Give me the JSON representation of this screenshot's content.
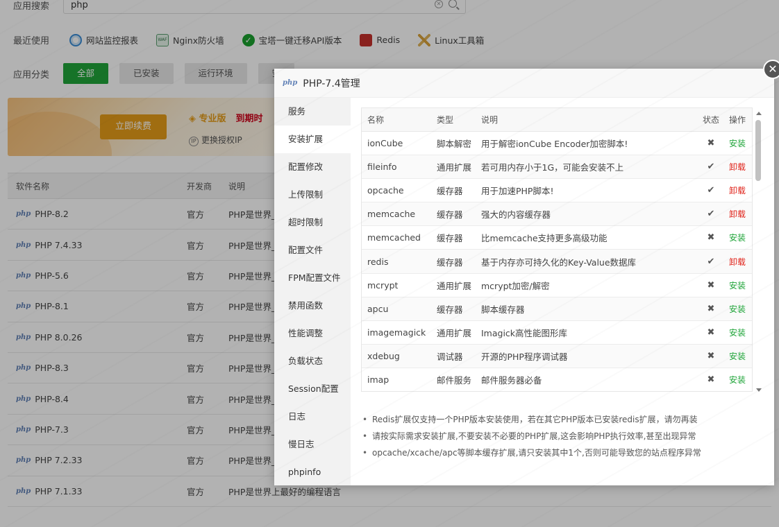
{
  "background": {
    "search_label": "应用搜索",
    "search_value": "php",
    "recent_label": "最近使用",
    "recent_items": [
      "网站监控报表",
      "Nginx防火墙",
      "宝塔一键迁移API版本",
      "Redis",
      "Linux工具箱"
    ],
    "category_label": "应用分类",
    "categories": [
      "全部",
      "已安装",
      "运行环境",
      "安"
    ],
    "banner": {
      "renew_label": "立即续费",
      "pro_label": "专业版",
      "expire_label": "到期时",
      "change_ip_label": "更换授权IP"
    },
    "table": {
      "headers": [
        "软件名称",
        "开发商",
        "说明"
      ],
      "rows": [
        {
          "name": "PHP-8.2",
          "vendor": "官方",
          "desc": "PHP是世界_"
        },
        {
          "name": "PHP 7.4.33",
          "vendor": "官方",
          "desc": "PHP是世界_"
        },
        {
          "name": "PHP-5.6",
          "vendor": "官方",
          "desc": "PHP是世界_"
        },
        {
          "name": "PHP-8.1",
          "vendor": "官方",
          "desc": "PHP是世界_"
        },
        {
          "name": "PHP 8.0.26",
          "vendor": "官方",
          "desc": "PHP是世界_"
        },
        {
          "name": "PHP-8.3",
          "vendor": "官方",
          "desc": "PHP是世界_"
        },
        {
          "name": "PHP-8.4",
          "vendor": "官方",
          "desc": "PHP是世界_"
        },
        {
          "name": "PHP-7.3",
          "vendor": "官方",
          "desc": "PHP是世界_"
        },
        {
          "name": "PHP 7.2.33",
          "vendor": "官方",
          "desc": "PHP是世界_"
        },
        {
          "name": "PHP 7.1.33",
          "vendor": "官方",
          "desc": "PHP是世界上最好的编程语言"
        }
      ]
    }
  },
  "modal": {
    "title": "PHP-7.4管理",
    "close_icon": "close-icon",
    "sidebar": [
      "服务",
      "安装扩展",
      "配置修改",
      "上传限制",
      "超时限制",
      "配置文件",
      "FPM配置文件",
      "禁用函数",
      "性能调整",
      "负载状态",
      "Session配置",
      "日志",
      "慢日志",
      "phpinfo"
    ],
    "active_sidebar_index": 1,
    "table": {
      "headers": {
        "name": "名称",
        "type": "类型",
        "desc": "说明",
        "status": "状态",
        "op": "操作"
      },
      "rows": [
        {
          "name": "ionCube",
          "type": "脚本解密",
          "desc": "用于解密ionCube Encoder加密脚本!",
          "status": "✖",
          "op": "安装",
          "installed": false
        },
        {
          "name": "fileinfo",
          "type": "通用扩展",
          "desc": "若可用内存小于1G，可能会安装不上",
          "status": "✔",
          "op": "卸载",
          "installed": true
        },
        {
          "name": "opcache",
          "type": "缓存器",
          "desc": "用于加速PHP脚本!",
          "status": "✔",
          "op": "卸载",
          "installed": true
        },
        {
          "name": "memcache",
          "type": "缓存器",
          "desc": "强大的内容缓存器",
          "status": "✔",
          "op": "卸载",
          "installed": true
        },
        {
          "name": "memcached",
          "type": "缓存器",
          "desc": "比memcache支持更多高级功能",
          "status": "✖",
          "op": "安装",
          "installed": false
        },
        {
          "name": "redis",
          "type": "缓存器",
          "desc": "基于内存亦可持久化的Key-Value数据库",
          "status": "✔",
          "op": "卸载",
          "installed": true
        },
        {
          "name": "mcrypt",
          "type": "通用扩展",
          "desc": "mcrypt加密/解密",
          "status": "✖",
          "op": "安装",
          "installed": false
        },
        {
          "name": "apcu",
          "type": "缓存器",
          "desc": "脚本缓存器",
          "status": "✖",
          "op": "安装",
          "installed": false
        },
        {
          "name": "imagemagick",
          "type": "通用扩展",
          "desc": "Imagick高性能图形库",
          "status": "✖",
          "op": "安装",
          "installed": false
        },
        {
          "name": "xdebug",
          "type": "调试器",
          "desc": "开源的PHP程序调试器",
          "status": "✖",
          "op": "安装",
          "installed": false
        },
        {
          "name": "imap",
          "type": "邮件服务",
          "desc": "邮件服务器必备",
          "status": "✖",
          "op": "安装",
          "installed": false
        }
      ]
    },
    "tips": [
      "Redis扩展仅支持一个PHP版本安装使用，若在其它PHP版本已安装redis扩展，请勿再装",
      "请按实际需求安装扩展,不要安装不必要的PHP扩展,这会影响PHP执行效率,甚至出现异常",
      "opcache/xcache/apc等脚本缓存扩展,请只安装其中1个,否则可能导致您的站点程序异常"
    ]
  },
  "colors": {
    "accent_green": "#20a53a",
    "uninstall_red": "#e0241b",
    "renew_orange": "#e59d19"
  }
}
